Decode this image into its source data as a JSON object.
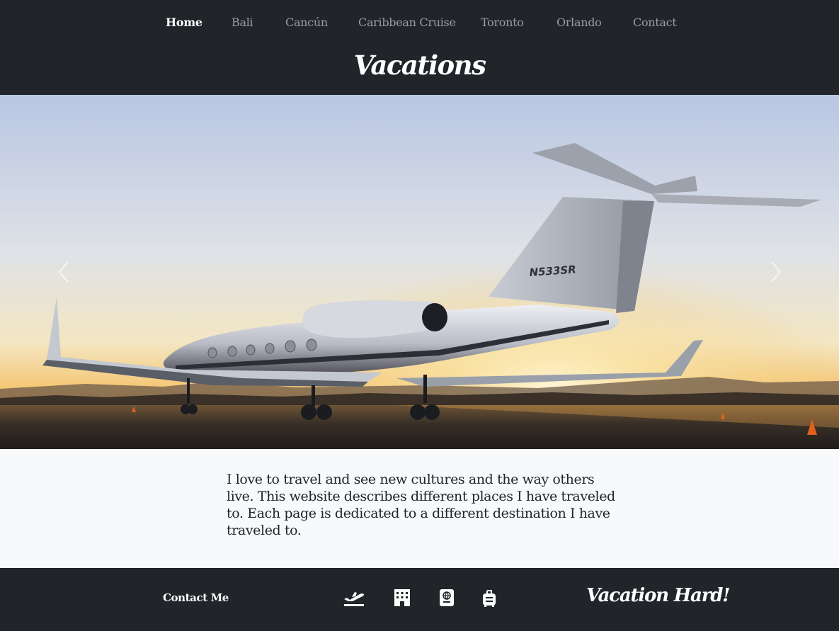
{
  "nav": {
    "items": [
      {
        "label": "Home",
        "active": true
      },
      {
        "label": "Bali"
      },
      {
        "label": "Cancún"
      },
      {
        "label": "Caribbean Cruise"
      },
      {
        "label": "Toronto"
      },
      {
        "label": "Orlando"
      },
      {
        "label": "Contact"
      }
    ]
  },
  "header": {
    "brand": "Vacations"
  },
  "carousel": {
    "slide_tail_number": "N533SR",
    "prev_icon": "chevron-left-icon",
    "next_icon": "chevron-right-icon"
  },
  "content": {
    "intro": "I love to travel and see new cultures and the way others live. This website describes different places I have traveled to. Each page is dedicated to a different destination I have traveled to."
  },
  "footer": {
    "contact_label": "Contact Me",
    "icons": [
      "plane-departure-icon",
      "hotel-icon",
      "passport-icon",
      "suitcase-icon"
    ],
    "brand": "Vacation Hard!"
  },
  "colors": {
    "dark": "#212529",
    "light": "#f8f9fa",
    "nav_inactive": "#9a9da1",
    "white": "#ffffff"
  }
}
